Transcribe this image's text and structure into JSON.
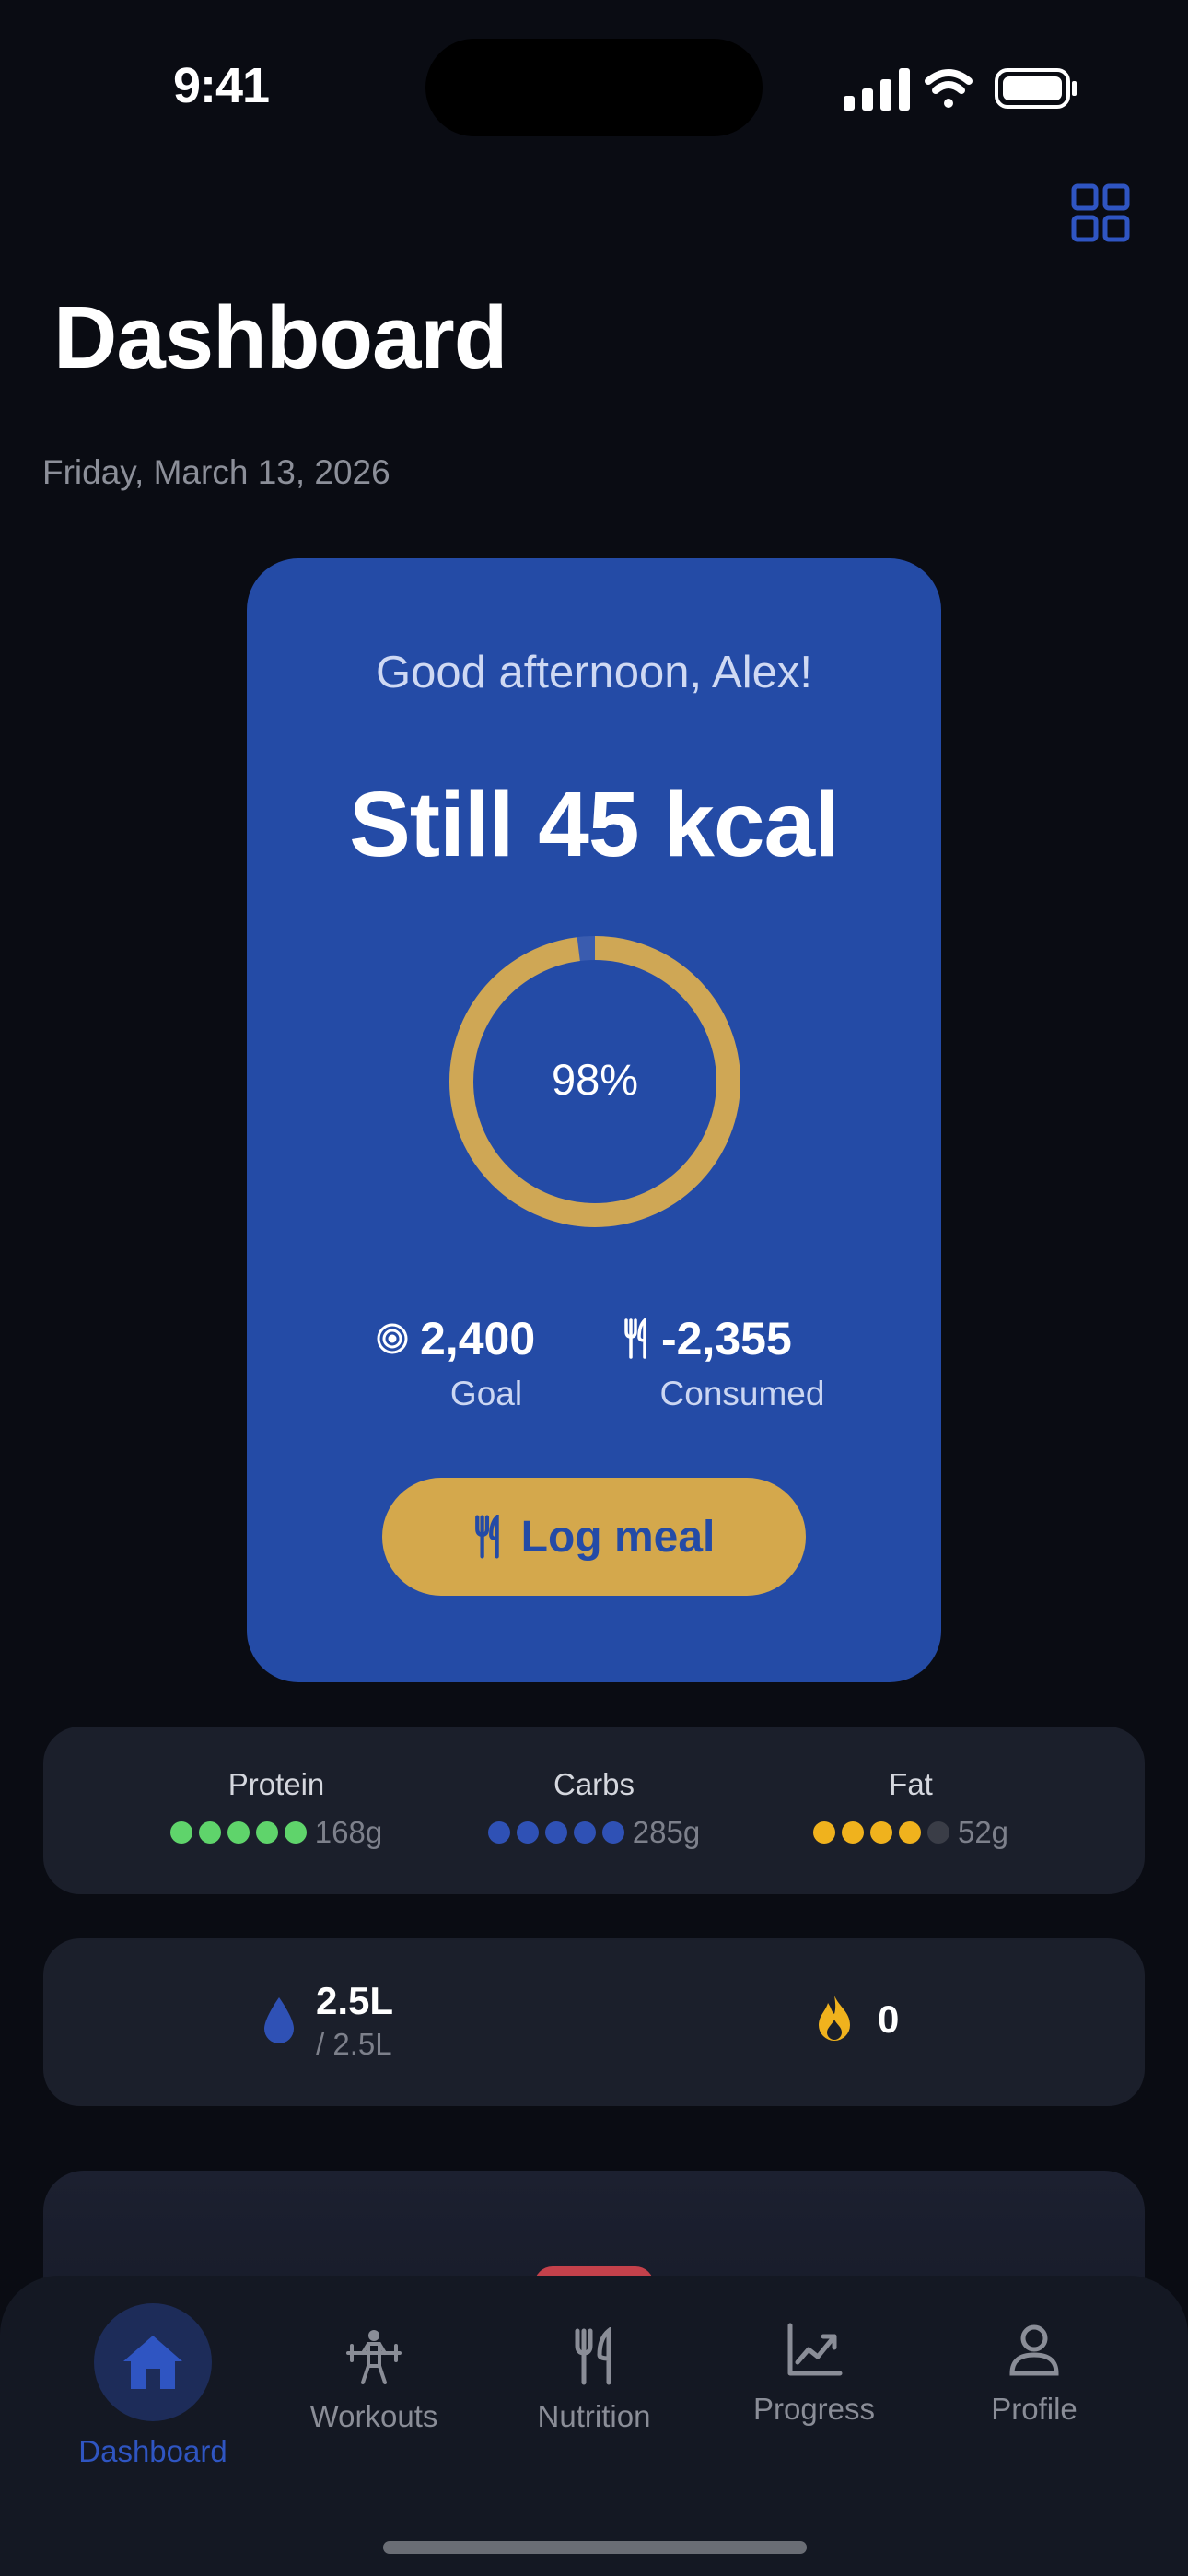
{
  "status_bar": {
    "time": "9:41"
  },
  "header": {
    "title": "Dashboard",
    "date": "Friday, March 13, 2026"
  },
  "hero": {
    "greeting": "Good afternoon, Alex!",
    "headline": "Still 45 kcal",
    "progress_label": "98%",
    "progress_fraction": 0.98,
    "goal_value": "2,400",
    "goal_label": "Goal",
    "consumed_value": "-2,355",
    "consumed_label": "Consumed",
    "log_button": "Log meal"
  },
  "macros": [
    {
      "name": "Protein",
      "amount": "168g",
      "filled": 5,
      "total": 5,
      "color": "#5fd46b"
    },
    {
      "name": "Carbs",
      "amount": "285g",
      "filled": 5,
      "total": 5,
      "color": "#2f51b5"
    },
    {
      "name": "Fat",
      "amount": "52g",
      "filled": 4,
      "total": 5,
      "color": "#f0b21d"
    }
  ],
  "water": {
    "value": "2.5L",
    "total": "/ 2.5L"
  },
  "streak": {
    "value": "0"
  },
  "tabs": [
    {
      "label": "Dashboard",
      "active": true
    },
    {
      "label": "Workouts",
      "active": false
    },
    {
      "label": "Nutrition",
      "active": false
    },
    {
      "label": "Progress",
      "active": false
    },
    {
      "label": "Profile",
      "active": false
    }
  ],
  "colors": {
    "background": "#0a0c13",
    "accent": "#244ba6",
    "gold": "#d4a84c",
    "card": "#1b1f2b"
  }
}
